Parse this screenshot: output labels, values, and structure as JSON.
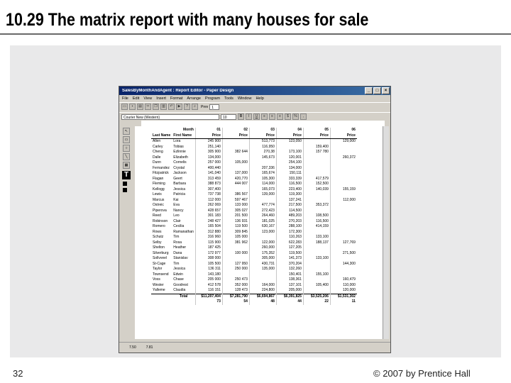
{
  "slide": {
    "title": "10.29 The matrix report with many houses for sale",
    "number": "32",
    "copyright": "© 2007 by Prentice Hall"
  },
  "window": {
    "title": "SalesByMonthAndAgent : Report Editor - Paper Design",
    "menu": [
      "File",
      "Edit",
      "View",
      "Insert",
      "Format",
      "Arrange",
      "Program",
      "Tools",
      "Window",
      "Help"
    ],
    "font_name": "Courier New (Western)",
    "font_size": "10",
    "format_buttons": [
      "B",
      "I",
      "U"
    ],
    "zoom_label": "Prev",
    "zoom_value": "1",
    "status_left": "7.50",
    "status_right": "7.81"
  },
  "report": {
    "month_header": "Month",
    "months": [
      "01",
      "02",
      "03",
      "04",
      "05",
      "06"
    ],
    "col_last": "Last Name",
    "col_first": "First Name",
    "price_label": "Price",
    "rows": [
      {
        "last": "Allen",
        "first": "Lora",
        "v": [
          "245 900",
          "",
          "513,773",
          "123,050",
          "",
          "129,000"
        ]
      },
      {
        "last": "Carley",
        "first": "Tobias",
        "v": [
          "251,140",
          "",
          "116,950",
          "",
          "159,400",
          ""
        ]
      },
      {
        "last": "Cheng",
        "first": "Ezlinnie",
        "v": [
          "305 900",
          "382 644",
          "270,38",
          "173,100",
          "157 780",
          ""
        ]
      },
      {
        "last": "Dalle",
        "first": "Elizabeth",
        "v": [
          "134,000",
          "",
          "145,673",
          "120,001",
          "",
          "260,372"
        ]
      },
      {
        "last": "Dunn",
        "first": "Cornelis",
        "v": [
          "257 000",
          "105,000",
          "",
          "254,100",
          "",
          ""
        ]
      },
      {
        "last": "Fernandez",
        "first": "Crystal",
        "v": [
          "400,440",
          "",
          "207,336",
          "134,000",
          "",
          ""
        ]
      },
      {
        "last": "Fitzpatrick",
        "first": "Jackson",
        "v": [
          "141,040",
          "137,000",
          "165,674",
          "150,111",
          "",
          ""
        ]
      },
      {
        "last": "Flagan",
        "first": "Geert",
        "v": [
          "313 459",
          "420,770",
          "105,300",
          "333,339",
          "417,579",
          ""
        ]
      },
      {
        "last": "Fleming",
        "first": "Barbara",
        "v": [
          "388 873",
          "444 007",
          "114,000",
          "116,500",
          "152,500",
          ""
        ]
      },
      {
        "last": "Kellogg",
        "first": "Jessica",
        "v": [
          "307,400",
          "",
          "165,073",
          "223,400",
          "140,039",
          "155,159"
        ]
      },
      {
        "last": "Lewis",
        "first": "Patricia",
        "v": [
          "737 738",
          "386 567",
          "139,000",
          "119,300",
          "",
          ""
        ]
      },
      {
        "last": "Marcus",
        "first": "Kai",
        "v": [
          "112 000",
          "597 467",
          "",
          "137,241",
          "",
          "112,000"
        ]
      },
      {
        "last": "Ostreic",
        "first": "Eva",
        "v": [
          "262 069",
          "133 000",
          "477,774",
          "217,500",
          "353,372",
          ""
        ]
      },
      {
        "last": "Piperova",
        "first": "Nancy",
        "v": [
          "428 657",
          "305 027",
          "272,423",
          "114,500",
          "",
          ""
        ]
      },
      {
        "last": "Reed",
        "first": "Leo",
        "v": [
          "301 183",
          "201 500",
          "264,460",
          "489,203",
          "108,500",
          ""
        ]
      },
      {
        "last": "Robinson",
        "first": "Clair",
        "v": [
          "248 427",
          "136 931",
          "181,025",
          "270,203",
          "116,500",
          ""
        ]
      },
      {
        "last": "Romero",
        "first": "Cecilia",
        "v": [
          "165 504",
          "119 500",
          "630,167",
          "288,100",
          "414,159",
          ""
        ]
      },
      {
        "last": "Rows",
        "first": "Ramanathan",
        "v": [
          "312 880",
          "309 845",
          "123,000",
          "172,300",
          "",
          ""
        ]
      },
      {
        "last": "Schutz",
        "first": "Tim",
        "v": [
          "316 960",
          "105 000",
          "",
          "110,263",
          "133,100",
          ""
        ]
      },
      {
        "last": "Selby",
        "first": "Rosa",
        "v": [
          "115 900",
          "381 962",
          "122,000",
          "622,283",
          "188,137",
          "127,769"
        ]
      },
      {
        "last": "Shelton",
        "first": "Heather",
        "v": [
          "187 425",
          "",
          "260,000",
          "127,205",
          "",
          ""
        ]
      },
      {
        "last": "Silverburg",
        "first": "Dana",
        "v": [
          "172 977",
          "100 000",
          "175,352",
          "119,500",
          "",
          "271,500"
        ]
      },
      {
        "last": "Sollvveel",
        "first": "Stanislav",
        "v": [
          "308 000",
          "",
          "305,000",
          "141,373",
          "133,100",
          ""
        ]
      },
      {
        "last": "St-Cage",
        "first": "Tim",
        "v": [
          "105 500",
          "127 950",
          "430,731",
          "370,204",
          "",
          "144,300"
        ]
      },
      {
        "last": "Taylor",
        "first": "Jessica",
        "v": [
          "136 311",
          "250 000",
          "135,000",
          "132,260",
          "",
          ""
        ]
      },
      {
        "last": "Townsend",
        "first": "Edwin",
        "v": [
          "143,180",
          "",
          "",
          "150,401",
          "155,100",
          ""
        ]
      },
      {
        "last": "Voss",
        "first": "Chase",
        "v": [
          "205 000",
          "250 473",
          "",
          "138,361",
          "",
          "160,479"
        ]
      },
      {
        "last": "Wester",
        "first": "Goodrest",
        "v": [
          "412 578",
          "352 000",
          "164,000",
          "137,101",
          "105,400",
          "110,000"
        ]
      },
      {
        "last": "Yalleme",
        "first": "Claudia",
        "v": [
          "116 151",
          "128 473",
          "224,800",
          "205,000",
          "",
          "120,000"
        ]
      }
    ],
    "total_label": "Total",
    "totals": [
      "$11,207,404",
      "$7,281,790",
      "$6,694,867",
      "$6,391,825",
      "$3,525,206",
      "$1,531,302"
    ],
    "counts": [
      "73",
      "54",
      "48",
      "44",
      "22",
      "11"
    ]
  }
}
